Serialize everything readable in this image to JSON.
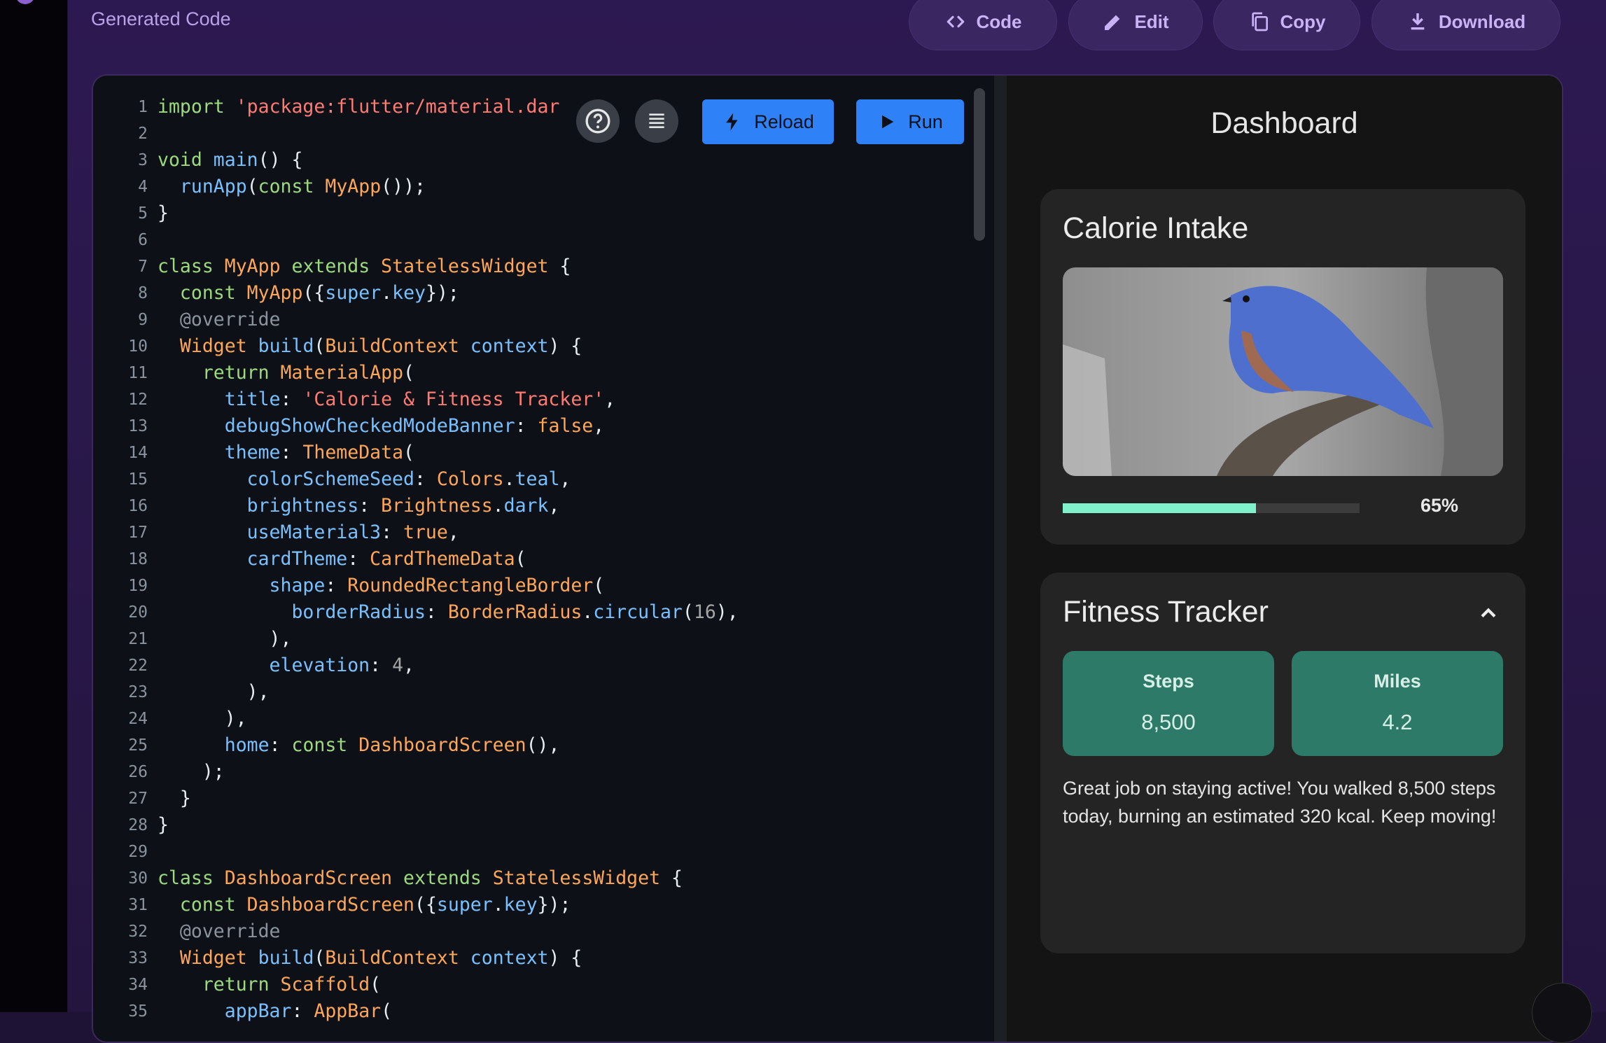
{
  "header": {
    "title": "Generated Code",
    "buttons": [
      {
        "label": "Code",
        "icon": "code-icon"
      },
      {
        "label": "Edit",
        "icon": "pencil-icon"
      },
      {
        "label": "Copy",
        "icon": "copy-icon"
      },
      {
        "label": "Download",
        "icon": "download-icon"
      }
    ]
  },
  "editor": {
    "reload_label": "Reload",
    "run_label": "Run",
    "help_icon": "help-circle-icon",
    "format_icon": "format-lines-icon",
    "code_lines": [
      "import 'package:flutter/material.dar",
      "",
      "void main() {",
      "  runApp(const MyApp());",
      "}",
      "",
      "class MyApp extends StatelessWidget {",
      "  const MyApp({super.key});",
      "  @override",
      "  Widget build(BuildContext context) {",
      "    return MaterialApp(",
      "      title: 'Calorie & Fitness Tracker',",
      "      debugShowCheckedModeBanner: false,",
      "      theme: ThemeData(",
      "        colorSchemeSeed: Colors.teal,",
      "        brightness: Brightness.dark,",
      "        useMaterial3: true,",
      "        cardTheme: CardThemeData(",
      "          shape: RoundedRectangleBorder(",
      "            borderRadius: BorderRadius.circular(16),",
      "          ),",
      "          elevation: 4,",
      "        ),",
      "      ),",
      "      home: const DashboardScreen(),",
      "    );",
      "  }",
      "}",
      "",
      "class DashboardScreen extends StatelessWidget {",
      "  const DashboardScreen({super.key});",
      "  @override",
      "  Widget build(BuildContext context) {",
      "    return Scaffold(",
      "      appBar: AppBar("
    ]
  },
  "preview": {
    "title": "Dashboard",
    "calorie_card": {
      "title": "Calorie Intake",
      "progress_fraction": 0.65,
      "progress_label": "65%",
      "progress_color": "#7ff2cc"
    },
    "fitness_card": {
      "title": "Fitness Tracker",
      "collapse_icon": "chevron-up-icon",
      "tiles": [
        {
          "label": "Steps",
          "value": "8,500"
        },
        {
          "label": "Miles",
          "value": "4.2"
        }
      ],
      "description": "Great job on staying active! You walked 8,500 steps today, burning an estimated 320 kcal. Keep moving!"
    }
  },
  "colors": {
    "accent_button": "#2f81f7",
    "tile_bg": "#2e7a68",
    "header_text": "#b9a2e6"
  }
}
